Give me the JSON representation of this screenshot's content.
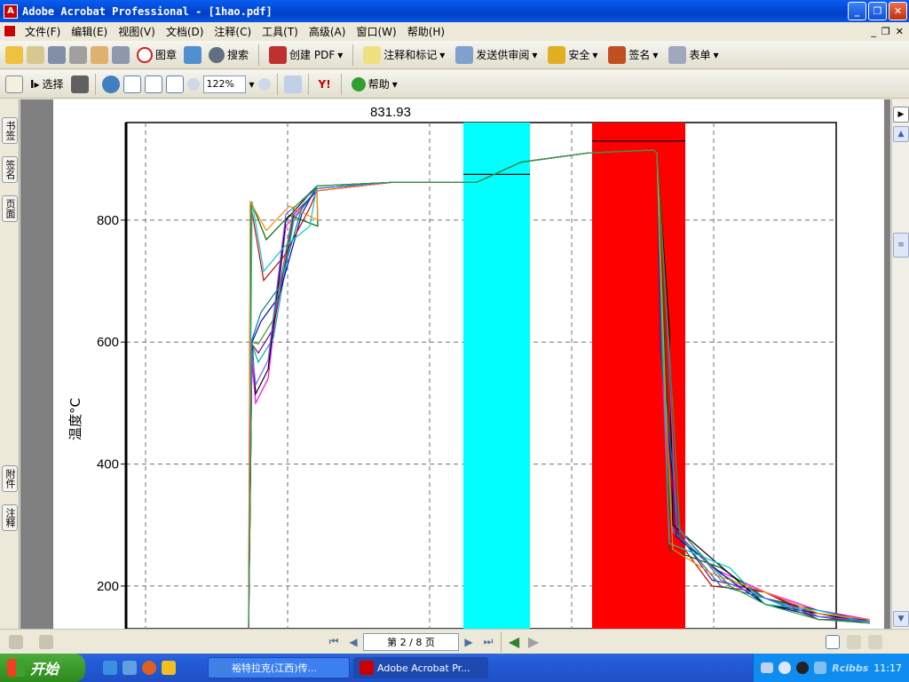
{
  "window": {
    "title": "Adobe Acrobat Professional - [1hao.pdf]"
  },
  "menu": [
    "文件(F)",
    "编辑(E)",
    "视图(V)",
    "文档(D)",
    "注释(C)",
    "工具(T)",
    "高级(A)",
    "窗口(W)",
    "帮助(H)"
  ],
  "toolbar1": {
    "stamp": "图章",
    "search": "搜索",
    "create_pdf": "创建 PDF",
    "comment_markup": "注释和标记",
    "send_review": "发送供审阅",
    "security": "安全",
    "sign": "签名",
    "forms": "表单"
  },
  "toolbar2": {
    "select": "选择",
    "zoom": "122%",
    "help": "帮助"
  },
  "lefttabs": {
    "bookmarks": "书签",
    "signatures": "签名",
    "pages": "页面",
    "attachments": "附件",
    "comments": "注释"
  },
  "nav": {
    "page_indicator": "第 2 / 8 页"
  },
  "taskbar": {
    "start": "开始",
    "task1": "裕特拉克(江西)传...",
    "task2": "Adobe Acrobat Pr...",
    "time": "11:17",
    "watermark": "Rcibbs"
  },
  "chart_data": {
    "type": "line",
    "ylabel": "温度°C",
    "yticks": [
      200,
      400,
      600,
      800
    ],
    "ylim": [
      130,
      960
    ],
    "annotation": "831.93",
    "bands": [
      {
        "color": "#00ffff",
        "x_start": 380,
        "x_end": 455,
        "hold_value": 875
      },
      {
        "color": "#ff0000",
        "x_start": 525,
        "x_end": 630,
        "hold_value": 930
      }
    ],
    "colors": [
      "#ff00ff",
      "#00aaaa",
      "#0000cc",
      "#cc0000",
      "#006600",
      "#000000",
      "#800080",
      "#008080",
      "#00cccc",
      "#ff8800",
      "#6666ff",
      "#339933"
    ]
  }
}
